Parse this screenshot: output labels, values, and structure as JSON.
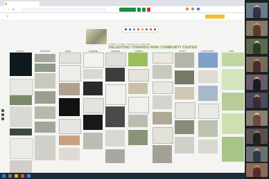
{
  "browser": {
    "tab_title": "",
    "url": ""
  },
  "board": {
    "subtitle": "LIBERTY PARK COMMUNITY CENTER",
    "title": "DELIGHTING TOWARDS PARK COMMUNITY CENTER"
  },
  "columns": [
    {
      "label": "SOCIAL"
    },
    {
      "label": "CONTEXT"
    },
    {
      "label": "PARK"
    },
    {
      "label": "SCHEME"
    },
    {
      "label": "SCHEME"
    },
    {
      "label": "SPRING"
    },
    {
      "label": ""
    },
    {
      "label": "STUDY"
    },
    {
      "label": "COMPONENT"
    },
    {
      "label": "JURY"
    }
  ],
  "colors": {
    "accent_green": "#6a9a2a",
    "meet_green": "#1e8e3e",
    "share_yellow": "#f0c23a",
    "taskbar": "#1f2b3a"
  },
  "icons": {
    "back": "arrow-left-icon",
    "forward": "arrow-right-icon",
    "reload": "reload-icon"
  }
}
